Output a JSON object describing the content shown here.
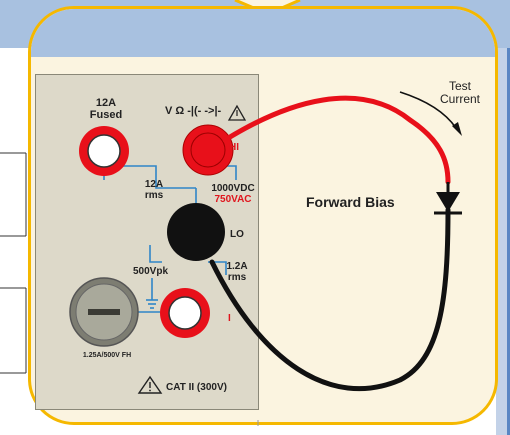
{
  "panel": {
    "fused_top": "12A",
    "fused_bottom": "Fused",
    "symbols": "V Ω -|(- ->|-",
    "hi": "HI",
    "amps_top": "12A",
    "amps_bottom": "rms",
    "volt_dc": "1000VDC",
    "volt_ac": "750VAC",
    "lo": "LO",
    "vpk": "500Vpk",
    "i_top": "1.2A",
    "i_bottom": "rms",
    "i": "I",
    "fuse_rating": "1.25A/500V FH",
    "cat_rating": "CAT II (300V)"
  },
  "circuit": {
    "test_top": "Test",
    "test_bottom": "Current",
    "forward_bias": "Forward Bias"
  },
  "colors": {
    "probe_red": "#e8101a",
    "probe_black": "#111111",
    "callout_border": "#f5b800",
    "callout_fill": "#fbf4e0",
    "panel_fill": "#ddd9c9",
    "red_label": "#e0141c"
  }
}
